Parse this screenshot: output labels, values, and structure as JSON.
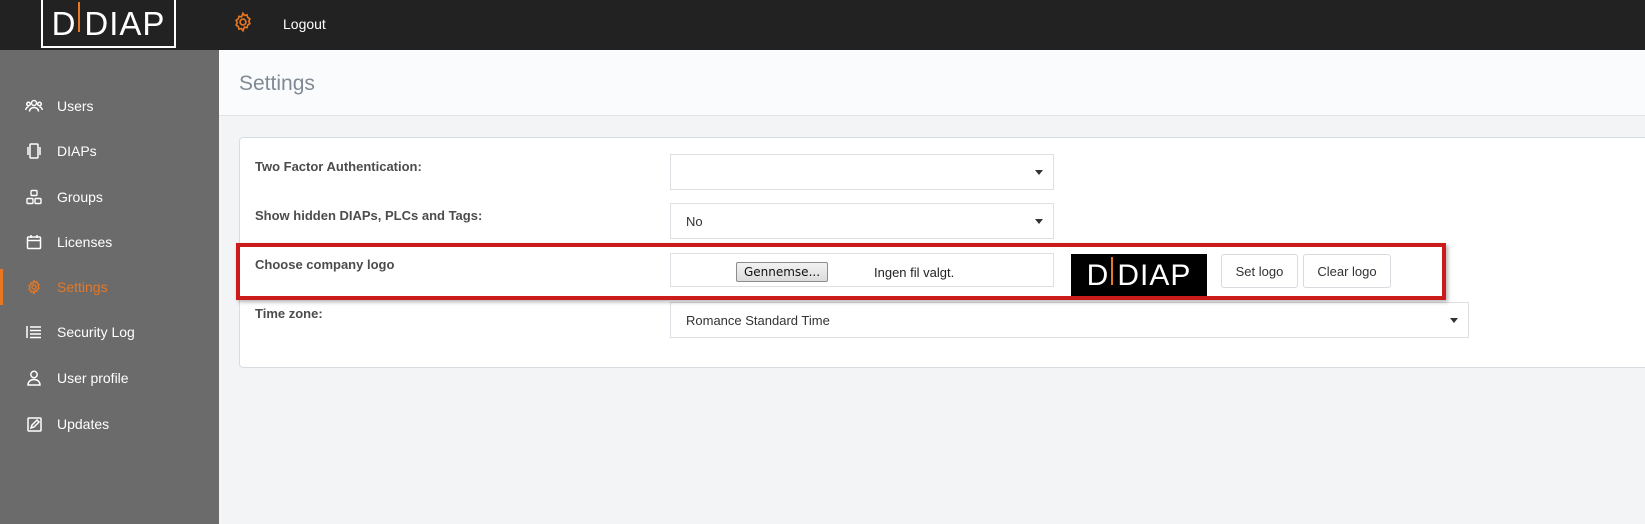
{
  "brand": {
    "logo_text": "DIAP",
    "accent_color": "#e87722"
  },
  "topbar": {
    "settings_icon": "gear-icon",
    "logout_label": "Logout"
  },
  "sidebar": {
    "items": [
      {
        "label": "Users",
        "icon": "users-icon",
        "active": false
      },
      {
        "label": "DIAPs",
        "icon": "device-icon",
        "active": false
      },
      {
        "label": "Groups",
        "icon": "groups-icon",
        "active": false
      },
      {
        "label": "Licenses",
        "icon": "calendar-icon",
        "active": false
      },
      {
        "label": "Settings",
        "icon": "gear-icon",
        "active": true
      },
      {
        "label": "Security Log",
        "icon": "list-icon",
        "active": false
      },
      {
        "label": "User profile",
        "icon": "user-icon",
        "active": false
      },
      {
        "label": "Updates",
        "icon": "edit-icon",
        "active": false
      }
    ]
  },
  "page": {
    "title": "Settings"
  },
  "settings": {
    "two_factor": {
      "label": "Two Factor Authentication:",
      "value": ""
    },
    "show_hidden": {
      "label": "Show hidden DIAPs, PLCs and Tags:",
      "value": "No"
    },
    "company_logo": {
      "label": "Choose company logo",
      "browse_label": "Gennemse...",
      "file_status": "Ingen fil valgt.",
      "preview_text": "DIAP",
      "set_label": "Set logo",
      "clear_label": "Clear logo"
    },
    "time_zone": {
      "label": "Time zone:",
      "value": "Romance Standard Time"
    }
  },
  "colors": {
    "sidebar_bg": "#6b6b6b",
    "topbar_bg": "#222222",
    "highlight": "#cc1b1b"
  }
}
